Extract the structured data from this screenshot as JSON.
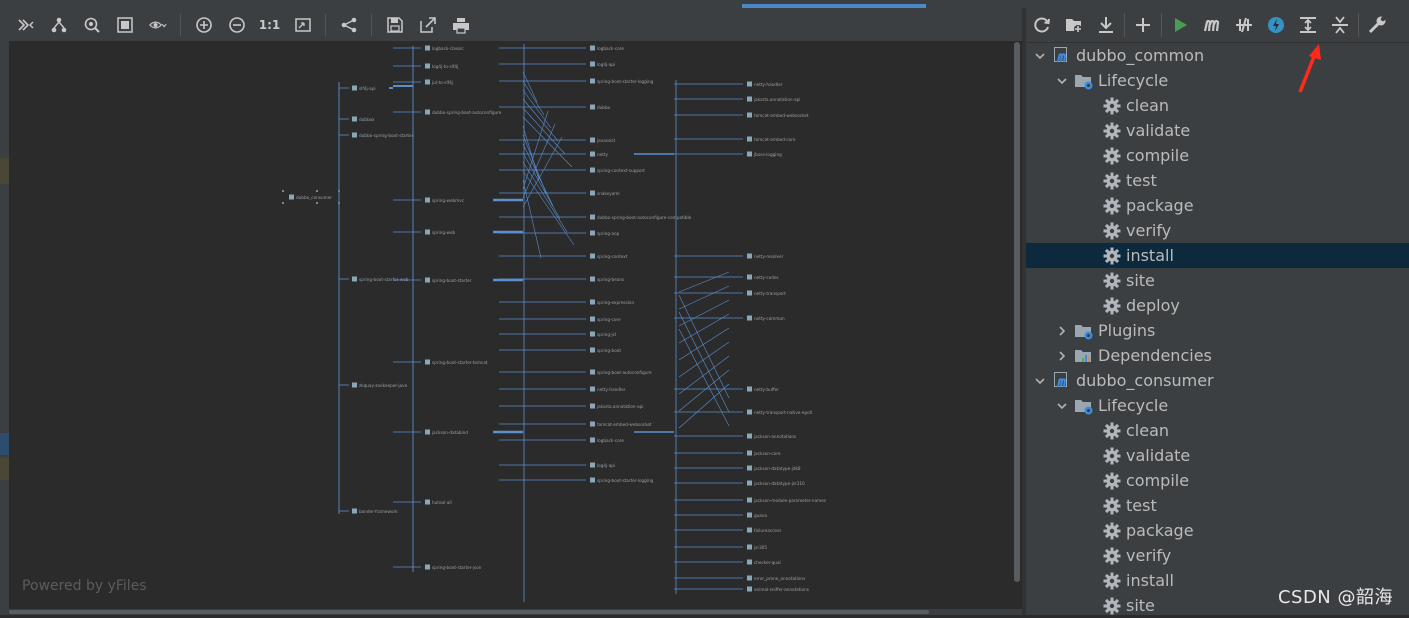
{
  "diagram": {
    "powered_by": "Powered by yFiles",
    "toolbar": {
      "actual_size_label": "1:1",
      "buttons": [
        "show-dependencies-icon",
        "hierarchic-layout-icon",
        "fit-content-icon",
        "selection-frame-icon",
        "visibility-icon",
        "zoom-in-icon",
        "zoom-out-icon",
        "actual-size-icon",
        "fit-page-icon",
        "share-icon",
        "save-icon",
        "export-icon",
        "print-icon"
      ]
    },
    "root_node": "dubbo_consumer",
    "nodes": [
      "slf4j-api",
      "dubbox",
      "dubbo-spring-boot-starter",
      "spring-boot-starter-web",
      "zkquay-zookeeper-java",
      "bander-framework",
      "logback-classic",
      "log4j-to-slf4j",
      "jul-to-slf4j",
      "dubbo-spring-boot-autoconfigure",
      "spring-webmvc",
      "spring-web",
      "spring-boot-starter",
      "spring-boot-starter-tomcat",
      "jackson-databind",
      "hutool-all",
      "spring-boot-starter-json",
      "logback-core",
      "log4j-api",
      "spring-boot-starter-logging",
      "dubbo",
      "javassist",
      "netty",
      "spring-context-support",
      "snakeyaml",
      "dubbo-spring-boot-autoconfigure-compatible",
      "spring-aop",
      "spring-context",
      "spring-beans",
      "spring-expression",
      "spring-core",
      "spring-jcl",
      "spring-boot",
      "spring-boot-autoconfigure",
      "netty-handler",
      "jakarta.annotation-api",
      "tomcat-embed-websocket",
      "tomcat-embed-core",
      "jboss-logging",
      "netty-resolver",
      "netty-codec",
      "netty-transport",
      "netty-common",
      "netty-buffer",
      "netty-transport-native-epoll",
      "jackson-annotations",
      "jackson-core",
      "jackson-datatype-jdk8",
      "jackson-datatype-jsr310",
      "jackson-module-parameter-names",
      "guava",
      "failureaccess",
      "jsr305",
      "checker-qual",
      "error_prone_annotations",
      "animal-sniffer-annotations",
      "listenablefuture",
      "j2objc-annotations",
      "log4j",
      "commons-lang"
    ]
  },
  "maven": {
    "toolbar": {
      "buttons": [
        "reload-icon",
        "add-project-icon",
        "download-icon",
        "add-icon",
        "run-icon",
        "execute-goal-icon",
        "skip-tests-icon",
        "offline-icon",
        "show-dependencies-icon",
        "collapse-all-icon",
        "settings-wrench-icon"
      ]
    },
    "tree": [
      {
        "label": "dubbo_common",
        "level": 0,
        "type": "project",
        "expanded": true
      },
      {
        "label": "Lifecycle",
        "level": 1,
        "type": "folder",
        "expanded": true
      },
      {
        "label": "clean",
        "level": 2,
        "type": "goal"
      },
      {
        "label": "validate",
        "level": 2,
        "type": "goal"
      },
      {
        "label": "compile",
        "level": 2,
        "type": "goal"
      },
      {
        "label": "test",
        "level": 2,
        "type": "goal"
      },
      {
        "label": "package",
        "level": 2,
        "type": "goal"
      },
      {
        "label": "verify",
        "level": 2,
        "type": "goal"
      },
      {
        "label": "install",
        "level": 2,
        "type": "goal",
        "selected": true
      },
      {
        "label": "site",
        "level": 2,
        "type": "goal"
      },
      {
        "label": "deploy",
        "level": 2,
        "type": "goal"
      },
      {
        "label": "Plugins",
        "level": 1,
        "type": "folder",
        "expanded": false
      },
      {
        "label": "Dependencies",
        "level": 1,
        "type": "deps",
        "expanded": false
      },
      {
        "label": "dubbo_consumer",
        "level": 0,
        "type": "project",
        "expanded": true
      },
      {
        "label": "Lifecycle",
        "level": 1,
        "type": "folder",
        "expanded": true
      },
      {
        "label": "clean",
        "level": 2,
        "type": "goal"
      },
      {
        "label": "validate",
        "level": 2,
        "type": "goal"
      },
      {
        "label": "compile",
        "level": 2,
        "type": "goal"
      },
      {
        "label": "test",
        "level": 2,
        "type": "goal"
      },
      {
        "label": "package",
        "level": 2,
        "type": "goal"
      },
      {
        "label": "verify",
        "level": 2,
        "type": "goal"
      },
      {
        "label": "install",
        "level": 2,
        "type": "goal"
      },
      {
        "label": "site",
        "level": 2,
        "type": "goal"
      }
    ]
  },
  "watermark": "CSDN @韶海",
  "colors": {
    "accent": "#4a88c7",
    "selection": "#0d293e",
    "edge": "#5b8fd0",
    "annotation_arrow": "#ff2a1a"
  }
}
